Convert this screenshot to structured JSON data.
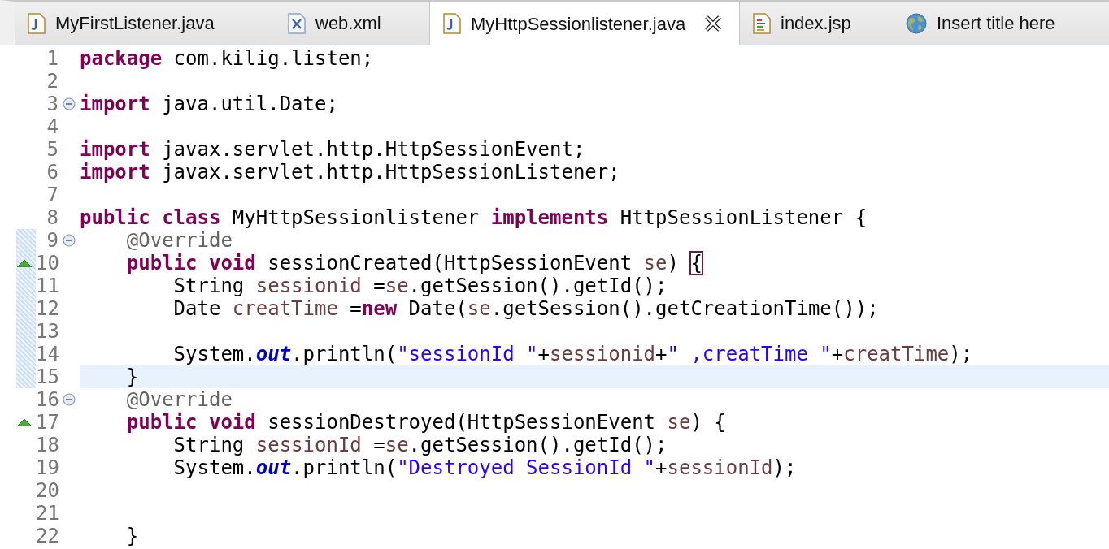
{
  "tabs": [
    {
      "label": "MyFirstListener.java",
      "selected": false
    },
    {
      "label": "web.xml",
      "selected": false
    },
    {
      "label": "MyHttpSessionlistener.java",
      "selected": true
    },
    {
      "label": "index.jsp",
      "selected": false
    },
    {
      "label": "Insert title here",
      "selected": false
    }
  ],
  "lines": [
    {
      "number": "1",
      "fold": false,
      "override": false,
      "changed": false,
      "current": false,
      "tokens": [
        {
          "kind": "keyword",
          "text": "package"
        },
        {
          "kind": "plain",
          "text": " com.kilig.listen;"
        }
      ]
    },
    {
      "number": "2",
      "fold": false,
      "override": false,
      "changed": false,
      "current": false
    },
    {
      "number": "3",
      "fold": true,
      "override": false,
      "changed": false,
      "current": false,
      "tokens": [
        {
          "kind": "keyword",
          "text": "import"
        },
        {
          "kind": "plain",
          "text": " java.util.Date;"
        }
      ]
    },
    {
      "number": "4",
      "fold": false,
      "override": false,
      "changed": false,
      "current": false
    },
    {
      "number": "5",
      "fold": false,
      "override": false,
      "changed": false,
      "current": false,
      "tokens": [
        {
          "kind": "keyword",
          "text": "import"
        },
        {
          "kind": "plain",
          "text": " javax.servlet.http.HttpSessionEvent;"
        }
      ]
    },
    {
      "number": "6",
      "fold": false,
      "override": false,
      "changed": false,
      "current": false,
      "tokens": [
        {
          "kind": "keyword",
          "text": "import"
        },
        {
          "kind": "plain",
          "text": " javax.servlet.http.HttpSessionListener;"
        }
      ]
    },
    {
      "number": "7",
      "fold": false,
      "override": false,
      "changed": false,
      "current": false
    },
    {
      "number": "8",
      "fold": false,
      "override": false,
      "changed": false,
      "current": false,
      "tokens": [
        {
          "kind": "keyword",
          "text": "public class"
        },
        {
          "kind": "plain",
          "text": " MyHttpSessionlistener "
        },
        {
          "kind": "keyword",
          "text": "implements"
        },
        {
          "kind": "plain",
          "text": " HttpSessionListener {"
        }
      ]
    },
    {
      "number": "9",
      "fold": true,
      "override": false,
      "changed": true,
      "current": false,
      "tokens": [
        {
          "kind": "annotation",
          "text": "    @Override"
        }
      ]
    },
    {
      "number": "10",
      "fold": false,
      "override": true,
      "changed": true,
      "current": false,
      "tokens": [
        {
          "kind": "keyword",
          "text": "    public void"
        },
        {
          "kind": "plain",
          "text": " sessionCreated(HttpSessionEvent "
        },
        {
          "kind": "local",
          "text": "se"
        },
        {
          "kind": "plain",
          "text": ") "
        },
        {
          "kind": "bracket",
          "text": "{"
        }
      ]
    },
    {
      "number": "11",
      "fold": false,
      "override": false,
      "changed": true,
      "current": false,
      "tokens": [
        {
          "kind": "plain",
          "text": "        String "
        },
        {
          "kind": "local",
          "text": "sessionid"
        },
        {
          "kind": "plain",
          "text": " ="
        },
        {
          "kind": "local",
          "text": "se"
        },
        {
          "kind": "plain",
          "text": ".getSession().getId();"
        }
      ]
    },
    {
      "number": "12",
      "fold": false,
      "override": false,
      "changed": true,
      "current": false,
      "tokens": [
        {
          "kind": "plain",
          "text": "        Date "
        },
        {
          "kind": "local",
          "text": "creatTime"
        },
        {
          "kind": "plain",
          "text": " ="
        },
        {
          "kind": "keyword",
          "text": "new"
        },
        {
          "kind": "plain",
          "text": " Date("
        },
        {
          "kind": "local",
          "text": "se"
        },
        {
          "kind": "plain",
          "text": ".getSession().getCreationTime());"
        }
      ]
    },
    {
      "number": "13",
      "fold": false,
      "override": false,
      "changed": true,
      "current": false
    },
    {
      "number": "14",
      "fold": false,
      "override": false,
      "changed": true,
      "current": false,
      "tokens": [
        {
          "kind": "plain",
          "text": "        System."
        },
        {
          "kind": "static",
          "text": "out"
        },
        {
          "kind": "plain",
          "text": ".println("
        },
        {
          "kind": "string",
          "text": "\"sessionId \""
        },
        {
          "kind": "plain",
          "text": "+"
        },
        {
          "kind": "local",
          "text": "sessionid"
        },
        {
          "kind": "plain",
          "text": "+"
        },
        {
          "kind": "string",
          "text": "\" ,creatTime \""
        },
        {
          "kind": "plain",
          "text": "+"
        },
        {
          "kind": "local",
          "text": "creatTime"
        },
        {
          "kind": "plain",
          "text": ");"
        }
      ]
    },
    {
      "number": "15",
      "fold": false,
      "override": false,
      "changed": true,
      "current": true,
      "tokens": [
        {
          "kind": "plain",
          "text": "    }"
        }
      ]
    },
    {
      "number": "16",
      "fold": true,
      "override": false,
      "changed": false,
      "current": false,
      "tokens": [
        {
          "kind": "annotation",
          "text": "    @Override"
        }
      ]
    },
    {
      "number": "17",
      "fold": false,
      "override": true,
      "changed": false,
      "current": false,
      "tokens": [
        {
          "kind": "keyword",
          "text": "    public void"
        },
        {
          "kind": "plain",
          "text": " sessionDestroyed(HttpSessionEvent "
        },
        {
          "kind": "local",
          "text": "se"
        },
        {
          "kind": "plain",
          "text": ") {"
        }
      ]
    },
    {
      "number": "18",
      "fold": false,
      "override": false,
      "changed": false,
      "current": false,
      "tokens": [
        {
          "kind": "plain",
          "text": "        String "
        },
        {
          "kind": "local",
          "text": "sessionId"
        },
        {
          "kind": "plain",
          "text": " ="
        },
        {
          "kind": "local",
          "text": "se"
        },
        {
          "kind": "plain",
          "text": ".getSession().getId();"
        }
      ]
    },
    {
      "number": "19",
      "fold": false,
      "override": false,
      "changed": false,
      "current": false,
      "tokens": [
        {
          "kind": "plain",
          "text": "        System."
        },
        {
          "kind": "static",
          "text": "out"
        },
        {
          "kind": "plain",
          "text": ".println("
        },
        {
          "kind": "string",
          "text": "\"Destroyed SessionId \""
        },
        {
          "kind": "plain",
          "text": "+"
        },
        {
          "kind": "local",
          "text": "sessionId"
        },
        {
          "kind": "plain",
          "text": ");"
        }
      ]
    },
    {
      "number": "20",
      "fold": false,
      "override": false,
      "changed": false,
      "current": false
    },
    {
      "number": "21",
      "fold": false,
      "override": false,
      "changed": false,
      "current": false
    },
    {
      "number": "22",
      "fold": false,
      "override": false,
      "changed": false,
      "current": false,
      "tokens": [
        {
          "kind": "plain",
          "text": "    }"
        }
      ]
    }
  ]
}
